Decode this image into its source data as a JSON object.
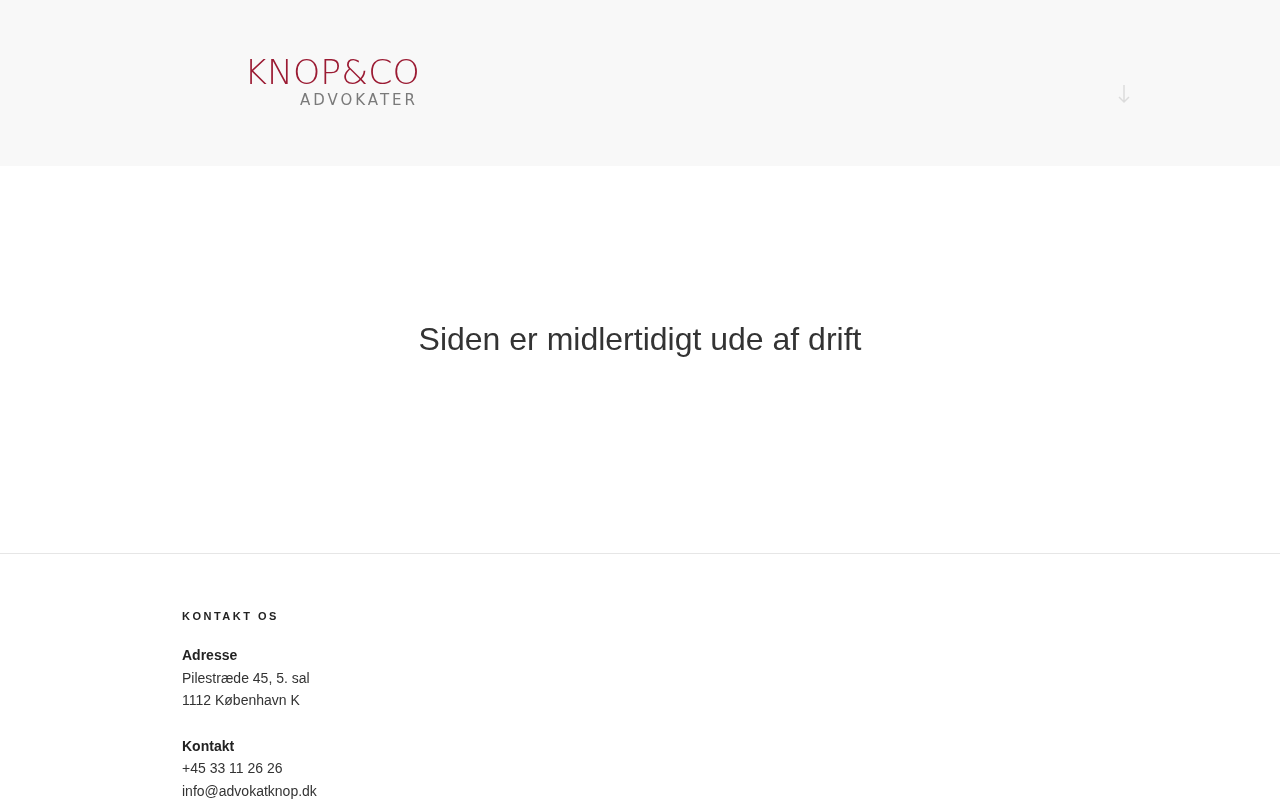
{
  "header": {
    "logo": {
      "name": "KNOP&CO",
      "tagline": "ADVOKATER"
    }
  },
  "main": {
    "message": "Siden er midlertidigt ude af drift"
  },
  "footer": {
    "heading": "KONTAKT OS",
    "blocks": [
      {
        "title": "Adresse",
        "lines": [
          "Pilestræde 45, 5. sal",
          "1112 København K"
        ]
      },
      {
        "title": "Kontakt",
        "lines": [
          "+45 33 11 26 26",
          "info@advokatknop.dk"
        ]
      }
    ]
  }
}
